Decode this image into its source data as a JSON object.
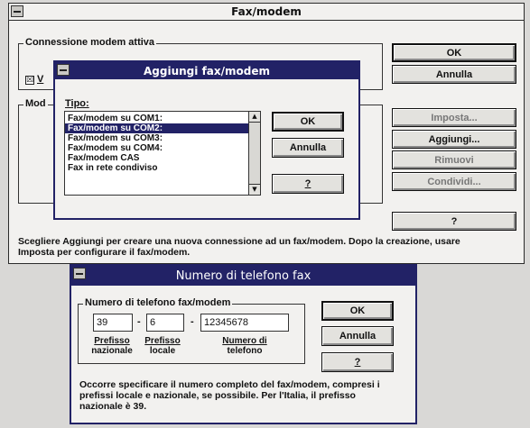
{
  "fax_modem": {
    "title": "Fax/modem",
    "group_active": "Connessione modem attiva",
    "checkbox_partial": "V",
    "group_modems_partial": "Mod",
    "buttons": {
      "ok": "OK",
      "cancel": "Annulla",
      "setup": "Imposta...",
      "add": "Aggiungi...",
      "remove": "Rimuovi",
      "share": "Condividi...",
      "help": "?"
    },
    "hint": "Scegliere Aggiungi per creare una nuova connessione ad un fax/modem. Dopo la creazione, usare Imposta per configurare il fax/modem."
  },
  "add_dialog": {
    "title": "Aggiungi fax/modem",
    "type_label": "Tipo:",
    "items": [
      "Fax/modem su COM1:",
      "Fax/modem su COM2:",
      "Fax/modem su COM3:",
      "Fax/modem su COM4:",
      "Fax/modem CAS",
      "Fax in rete condiviso"
    ],
    "selected_index": 1,
    "ok": "OK",
    "cancel": "Annulla",
    "help": "?"
  },
  "phone_dialog": {
    "title": "Numero di telefono fax",
    "group": "Numero di telefono fax/modem",
    "fields": {
      "national_prefix": "39",
      "local_prefix": "6",
      "number": "12345678"
    },
    "labels": {
      "national_1": "Prefisso",
      "national_2": "nazionale",
      "local_1": "Prefisso",
      "local_2": "locale",
      "number_1": "Numero di",
      "number_2": "telefono"
    },
    "dash": "-",
    "ok": "OK",
    "cancel": "Annulla",
    "help": "?",
    "note": "Occorre specificare il numero completo del fax/modem, compresi i prefissi locale e nazionale, se possibile. Per l'Italia, il prefisso nazionale è 39."
  },
  "colors": {
    "active_title": "#222266",
    "window_bg": "#f2f1ef",
    "desktop": "#d9d8d6"
  }
}
